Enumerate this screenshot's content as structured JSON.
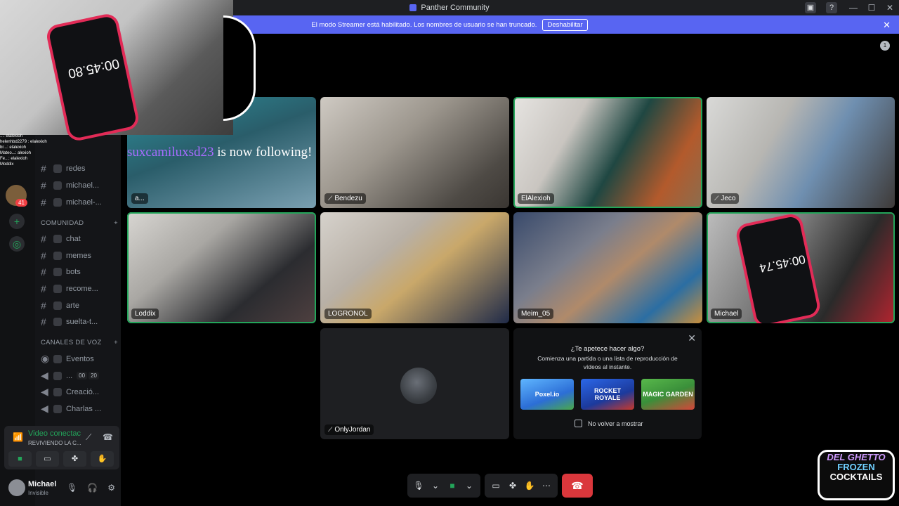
{
  "window": {
    "title": "Panther Community",
    "controls": [
      "—",
      "☐",
      "✕"
    ],
    "toolbar_icons": [
      "▣",
      "?"
    ]
  },
  "banner": {
    "text": "El modo Streamer está habilitado. Los nombres de usuario se han truncado.",
    "button": "Deshabilitar",
    "close": "✕"
  },
  "servers": {
    "badge_count": "41",
    "add": "+",
    "explore": "◎"
  },
  "channels": {
    "items_top": [
      {
        "label": "redes"
      },
      {
        "label": "michael..."
      },
      {
        "label": "michael-..."
      }
    ],
    "community_label": "COMUNIDAD",
    "community": [
      {
        "label": "chat"
      },
      {
        "label": "memes"
      },
      {
        "label": "bots"
      },
      {
        "label": "recome..."
      },
      {
        "label": "arte"
      },
      {
        "label": "suelta-t..."
      }
    ],
    "voice_label": "CANALES DE VOZ",
    "voice": [
      {
        "label": "Eventos"
      },
      {
        "label": "...",
        "count_a": "00",
        "count_b": "20"
      },
      {
        "label": "Creació..."
      },
      {
        "label": "Charlas ..."
      }
    ]
  },
  "rtc": {
    "title": "Video conectac",
    "subtitle": "REVIVIENDO LA C..."
  },
  "user": {
    "name": "Michael",
    "status": "Invisible"
  },
  "tiles": [
    {
      "name": "a..."
    },
    {
      "name": "Bendezu"
    },
    {
      "name": "ElAlexioh"
    },
    {
      "name": "Jeco"
    },
    {
      "name": "Loddix"
    },
    {
      "name": "LOGRONOL"
    },
    {
      "name": "Meim_05"
    },
    {
      "name": "Michael"
    },
    {
      "name": "OnlyJordan"
    }
  ],
  "activity": {
    "title": "¿Te apetece hacer algo?",
    "subtitle": "Comienza una partida o una lista de reproducción de vídeos al instante.",
    "games": [
      "Poxel.io",
      "ROCKET ROYALE",
      "MAGIC GARDEN"
    ],
    "checkbox": "No volver a mostrar",
    "close": "✕"
  },
  "stream_overlay": {
    "timer": "00:45.80",
    "tile_timer": "00:45.74",
    "follow_user": "suxcamiluxsd23",
    "follow_text": " is now following!",
    "chat": [
      "...: elalexioh",
      "helenhbd2279 : elalexioh",
      "br...: elalexioh",
      "Mateo...: alexioh",
      "Fe...: elalexioh",
      "Moddix"
    ]
  },
  "logo": {
    "line1": "DEL GHETTO",
    "line2": "FROZEN",
    "line3": "COCKTAILS"
  },
  "colors": {
    "accent": "#5865f2",
    "speaking": "#23a55a",
    "hangup": "#da373c"
  }
}
